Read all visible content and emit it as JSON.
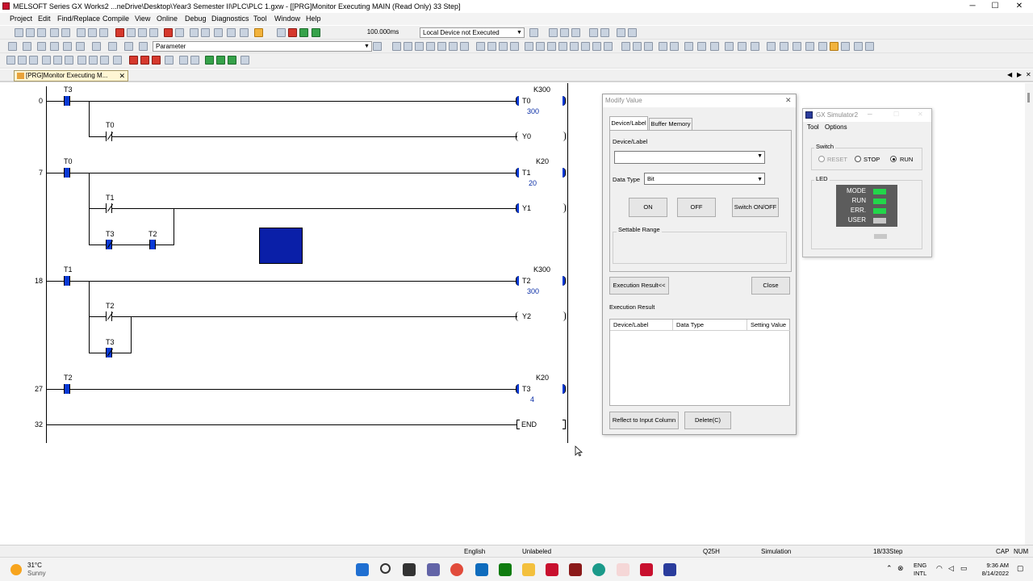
{
  "window": {
    "title": "MELSOFT Series GX Works2 ...neDrive\\Desktop\\Year3 Semester II\\PLC\\PLC 1.gxw - [[PRG]Monitor Executing MAIN (Read Only) 33 Step]",
    "min": "─",
    "max": "☐",
    "close": "✕"
  },
  "menu": [
    "Project",
    "Edit",
    "Find/Replace",
    "Compile",
    "View",
    "Online",
    "Debug",
    "Diagnostics",
    "Tool",
    "Window",
    "Help"
  ],
  "toolbar": {
    "scan_time": "100.000ms",
    "status_combo": "Local Device not Executed",
    "parameter_combo": "Parameter"
  },
  "tab": {
    "label": "[PRG]Monitor Executing M...",
    "close": "✕"
  },
  "ladder": {
    "step_numbers": [
      "0",
      "7",
      "18",
      "27",
      "32"
    ],
    "rung0": {
      "contact": "T3",
      "coil": "T0",
      "const": "K300",
      "value": "300",
      "branch_contact": "T0",
      "branch_coil": "Y0"
    },
    "rung7": {
      "contact": "T0",
      "coil": "T1",
      "const": "K20",
      "value": "20",
      "branch_contact": "T1",
      "branch_coil": "Y1",
      "sub_contact1": "T3",
      "sub_contact2": "T2"
    },
    "rung18": {
      "contact": "T1",
      "coil": "T2",
      "const": "K300",
      "value": "300",
      "branch_contact": "T2",
      "branch_coil": "Y2",
      "sub_contact": "T3"
    },
    "rung27": {
      "contact": "T2",
      "coil": "T3",
      "const": "K20",
      "value": "4"
    },
    "end": "END"
  },
  "modify_value": {
    "title": "Modify Value",
    "close": "✕",
    "tab_device": "Device/Label",
    "tab_buffer": "Buffer Memory",
    "device_label": "Device/Label",
    "device_value": "",
    "data_type_label": "Data Type",
    "data_type_value": "Bit",
    "on_button": "ON",
    "off_button": "OFF",
    "switch_button": "Switch ON/OFF",
    "settable_range": "Settable Range",
    "exec_result_button": "Execution Result<<",
    "close_button": "Close",
    "exec_result_label": "Execution Result",
    "columns": [
      "Device/Label",
      "Data Type",
      "Setting Value"
    ],
    "reflect_button": "Reflect to Input Column",
    "delete_button": "Delete(C)"
  },
  "gx_simulator": {
    "title": "GX Simulator2",
    "menu": [
      "Tool",
      "Options"
    ],
    "switch_label": "Switch",
    "reset": "RESET",
    "stop": "STOP",
    "run": "RUN",
    "selected": "RUN",
    "led_label": "LED",
    "leds": [
      {
        "name": "MODE",
        "color": "#22d64a"
      },
      {
        "name": "RUN",
        "color": "#22d64a"
      },
      {
        "name": "ERR.",
        "color": "#22d64a"
      },
      {
        "name": "USER",
        "color": "#c8c8c8"
      }
    ]
  },
  "statusbar": {
    "language": "English",
    "label": "Unlabeled",
    "cpu": "Q25H",
    "mode": "Simulation",
    "steps": "18/33Step",
    "cap": "CAP",
    "num": "NUM"
  },
  "taskbar": {
    "weather_temp": "31°C",
    "weather_desc": "Sunny",
    "lang1": "ENG",
    "lang2": "INTL",
    "time": "9:36 AM",
    "date": "8/14/2022"
  },
  "colors": {
    "active_blue": "#0a3ad6",
    "monitor_block": "#0a1fa8",
    "led_green": "#22d64a"
  }
}
